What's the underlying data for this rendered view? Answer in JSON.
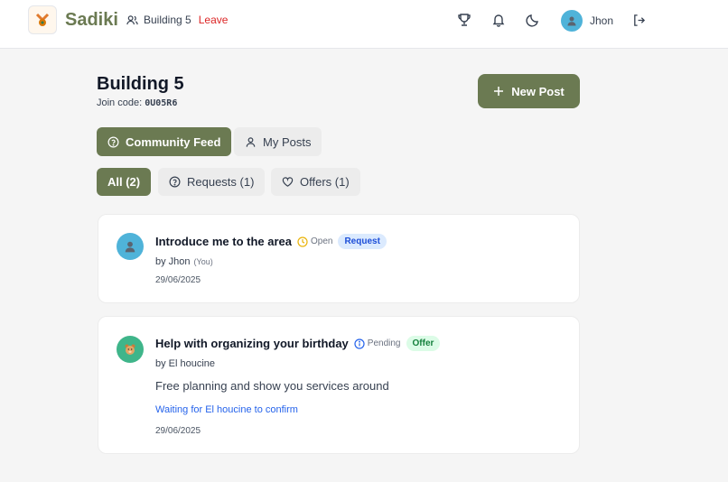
{
  "header": {
    "brand": "Sadiki",
    "building": "Building 5",
    "leave": "Leave",
    "user_name": "Jhon"
  },
  "page": {
    "title": "Building 5",
    "join_label": "Join code:",
    "join_code": "0U05R6",
    "new_post": "New Post"
  },
  "tabs": [
    {
      "label": "Community Feed",
      "active": true
    },
    {
      "label": "My Posts",
      "active": false
    }
  ],
  "filters": [
    {
      "label": "All (2)",
      "active": true
    },
    {
      "label": "Requests (1)",
      "active": false
    },
    {
      "label": "Offers (1)",
      "active": false
    }
  ],
  "posts": [
    {
      "title": "Introduce me to the area",
      "status": "Open",
      "type": "Request",
      "author": "by Jhon",
      "you": "(You)",
      "date": "29/06/2025"
    },
    {
      "title": "Help with organizing your birthday",
      "status": "Pending",
      "type": "Offer",
      "author": "by El houcine",
      "description": "Free planning and show you services around",
      "waiting": "Waiting for El houcine to confirm",
      "date": "29/06/2025"
    }
  ],
  "colors": {
    "brand": "#6b7a52",
    "leave": "#dc2626",
    "request_badge_bg": "#dbeafe",
    "offer_badge_bg": "#dcfce7",
    "link": "#2563eb"
  }
}
